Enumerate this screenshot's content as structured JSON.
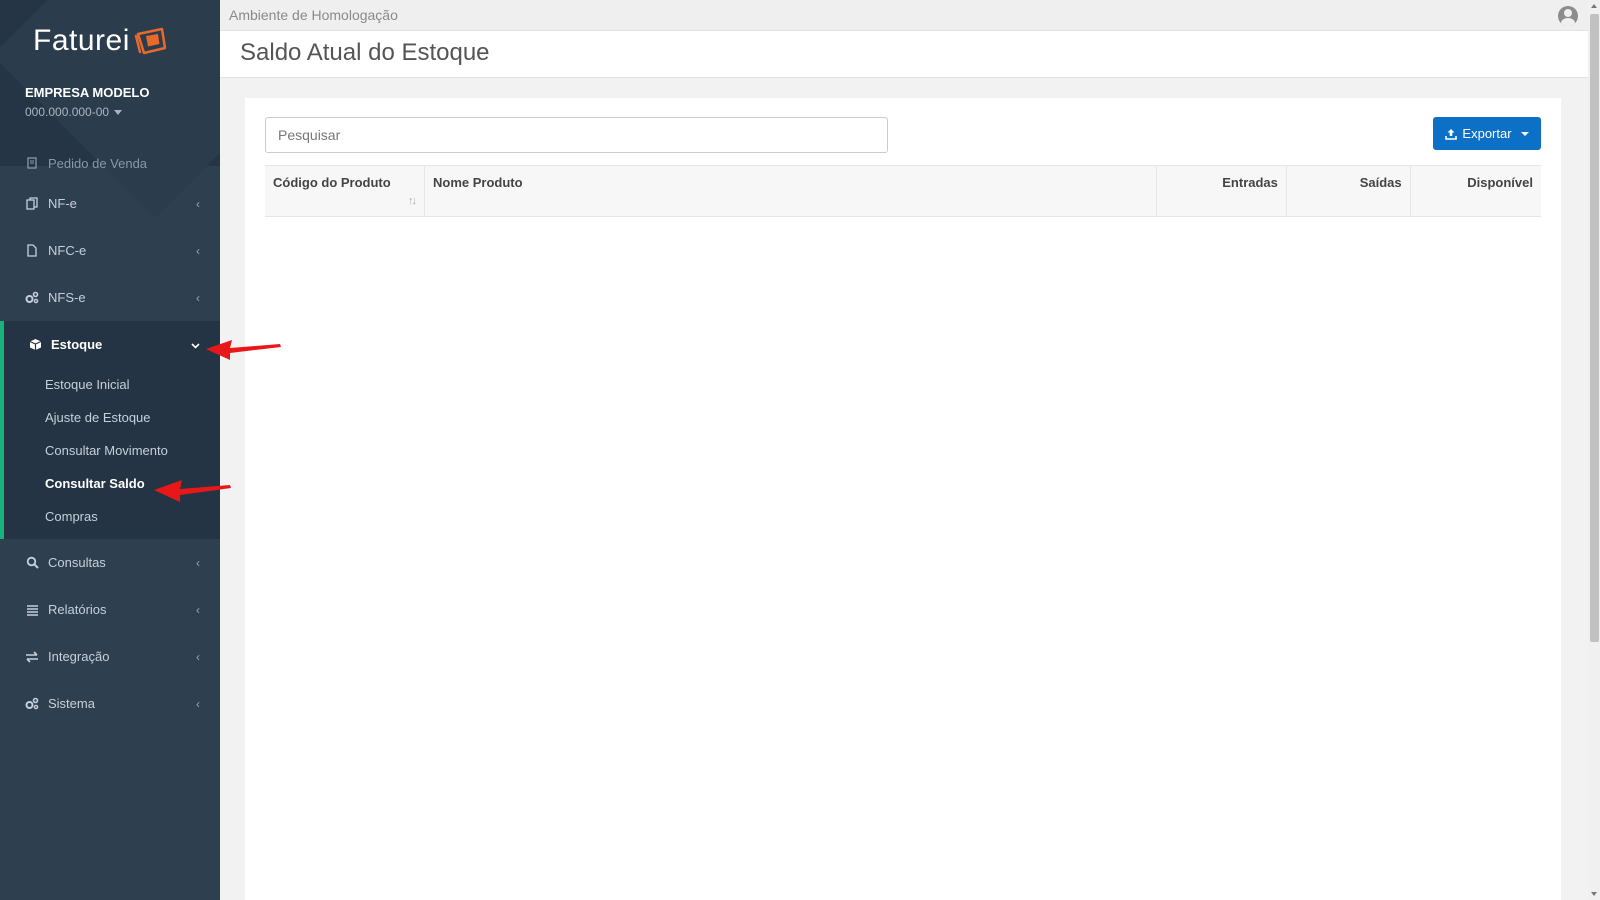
{
  "sidebar": {
    "logo_text": "Faturei",
    "company_name": "EMPRESA MODELO",
    "company_id": "000.000.000-00",
    "items": [
      {
        "label": "Pedido de Venda",
        "icon": "document-icon"
      },
      {
        "label": "NF-e",
        "icon": "copy-icon"
      },
      {
        "label": "NFC-e",
        "icon": "file-icon"
      },
      {
        "label": "NFS-e",
        "icon": "gears-icon"
      },
      {
        "label": "Estoque",
        "icon": "cube-icon"
      },
      {
        "label": "Consultas",
        "icon": "search-icon"
      },
      {
        "label": "Relatórios",
        "icon": "list-icon"
      },
      {
        "label": "Integração",
        "icon": "exchange-icon"
      },
      {
        "label": "Sistema",
        "icon": "gears-icon"
      }
    ],
    "estoque_subitems": [
      {
        "label": "Estoque Inicial"
      },
      {
        "label": "Ajuste de Estoque"
      },
      {
        "label": "Consultar Movimento"
      },
      {
        "label": "Consultar Saldo",
        "active": true
      },
      {
        "label": "Compras"
      }
    ]
  },
  "topbar": {
    "environment": "Ambiente de Homologação"
  },
  "page": {
    "title": "Saldo Atual do Estoque",
    "search_placeholder": "Pesquisar",
    "export_label": "Exportar"
  },
  "table": {
    "columns": [
      {
        "label": "Código do Produto"
      },
      {
        "label": "Nome Produto"
      },
      {
        "label": "Entradas"
      },
      {
        "label": "Saídas"
      },
      {
        "label": "Disponível"
      }
    ],
    "rows": []
  },
  "colors": {
    "sidebar_bg": "#2e3f50",
    "active_accent": "#18b37d",
    "logo_accent": "#e8692a",
    "primary_button": "#0c70c6",
    "annotation_arrow": "#e81818"
  }
}
